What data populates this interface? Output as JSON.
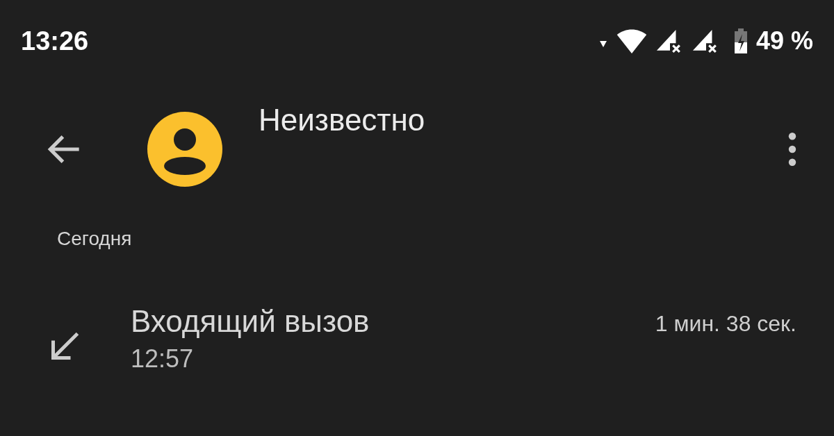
{
  "status_bar": {
    "time": "13:26",
    "battery": "49 %"
  },
  "header": {
    "title": "Неизвестно"
  },
  "sections": [
    {
      "title": "Сегодня",
      "calls": [
        {
          "kind": "incoming",
          "type": "Входящий вызов",
          "time": "12:57",
          "duration": "1 мин. 38 сек."
        }
      ]
    }
  ]
}
